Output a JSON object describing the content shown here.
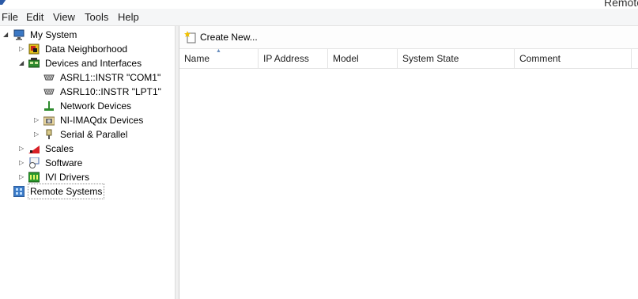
{
  "window": {
    "title": "Remote"
  },
  "menu": {
    "file": "File",
    "edit": "Edit",
    "view": "View",
    "tools": "Tools",
    "help": "Help"
  },
  "tree": {
    "my_system": "My System",
    "data_neighborhood": "Data Neighborhood",
    "devices_interfaces": "Devices and Interfaces",
    "asrl1": "ASRL1::INSTR \"COM1\"",
    "asrl10": "ASRL10::INSTR \"LPT1\"",
    "network_devices": "Network Devices",
    "ni_imaqdx": "NI-IMAQdx Devices",
    "serial_parallel": "Serial & Parallel",
    "scales": "Scales",
    "software": "Software",
    "ivi_drivers": "IVI Drivers",
    "remote_systems": "Remote Systems"
  },
  "toolbar": {
    "create_new": "Create New..."
  },
  "list": {
    "columns": [
      "Name",
      "IP Address",
      "Model",
      "System State",
      "Comment"
    ],
    "rows": []
  },
  "icons": {
    "expanded": "triangle-expanded-icon",
    "collapsed": "triangle-collapsed-icon"
  }
}
